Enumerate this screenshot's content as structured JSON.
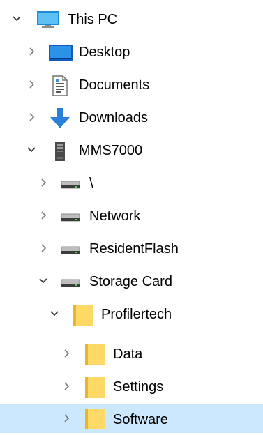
{
  "tree": {
    "this_pc": {
      "label": "This PC",
      "expanded": true,
      "icon": "computer-icon"
    },
    "desktop": {
      "label": "Desktop",
      "expanded": false,
      "icon": "desktop-folder-icon"
    },
    "documents": {
      "label": "Documents",
      "expanded": false,
      "icon": "documents-folder-icon"
    },
    "downloads": {
      "label": "Downloads",
      "expanded": false,
      "icon": "download-arrow-icon"
    },
    "mms7000": {
      "label": "MMS7000",
      "expanded": true,
      "icon": "device-icon"
    },
    "root": {
      "label": "\\",
      "expanded": false,
      "icon": "drive-icon"
    },
    "network": {
      "label": "Network",
      "expanded": false,
      "icon": "drive-icon"
    },
    "residentflash": {
      "label": "ResidentFlash",
      "expanded": false,
      "icon": "drive-icon"
    },
    "storage_card": {
      "label": "Storage Card",
      "expanded": true,
      "icon": "drive-icon"
    },
    "profilertech": {
      "label": "Profilertech",
      "expanded": true,
      "icon": "folder-icon"
    },
    "data": {
      "label": "Data",
      "expanded": false,
      "icon": "folder-icon"
    },
    "settings": {
      "label": "Settings",
      "expanded": false,
      "icon": "folder-icon"
    },
    "software": {
      "label": "Software",
      "expanded": false,
      "selected": true,
      "icon": "folder-icon"
    }
  },
  "colors": {
    "selection": "#cce8ff",
    "folder": "#ffd966",
    "chevron": "#7a7a7a"
  }
}
